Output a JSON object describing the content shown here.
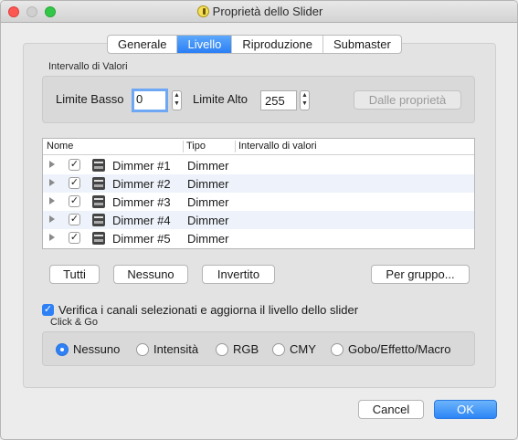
{
  "window": {
    "title": "Proprietà dello Slider"
  },
  "tabs": [
    {
      "label": "Generale"
    },
    {
      "label": "Livello"
    },
    {
      "label": "Riproduzione"
    },
    {
      "label": "Submaster"
    }
  ],
  "range": {
    "group_label": "Intervallo di Valori",
    "low_label": "Limite Basso",
    "low_value": "0",
    "high_label": "Limite Alto",
    "high_value": "255",
    "from_props_button": "Dalle proprietà"
  },
  "table": {
    "columns": [
      "Nome",
      "Tipo",
      "Intervallo di valori"
    ],
    "rows": [
      {
        "name": "Dimmer #1",
        "type": "Dimmer",
        "range": "",
        "checked": "✓"
      },
      {
        "name": "Dimmer #2",
        "type": "Dimmer",
        "range": "",
        "checked": "✓"
      },
      {
        "name": "Dimmer #3",
        "type": "Dimmer",
        "range": "",
        "checked": "✓"
      },
      {
        "name": "Dimmer #4",
        "type": "Dimmer",
        "range": "",
        "checked": "✓"
      },
      {
        "name": "Dimmer #5",
        "type": "Dimmer",
        "range": "",
        "checked": "✓"
      }
    ]
  },
  "actions": {
    "all": "Tutti",
    "none": "Nessuno",
    "invert": "Invertito",
    "by_group": "Per gruppo..."
  },
  "monitor": {
    "checkmark": "✓",
    "label": "Verifica i canali selezionati e aggiorna il livello dello slider"
  },
  "click_go": {
    "group_label": "Click & Go",
    "options": [
      "Nessuno",
      "Intensità",
      "RGB",
      "CMY",
      "Gobo/Effetto/Macro"
    ],
    "selected": "Nessuno"
  },
  "footer": {
    "cancel": "Cancel",
    "ok": "OK"
  },
  "colors": {
    "accent": "#2e80f5",
    "window_bg": "#ececec"
  }
}
